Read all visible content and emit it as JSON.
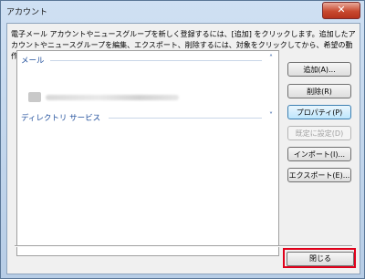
{
  "window": {
    "title": "アカウント",
    "close_glyph": "✕"
  },
  "description": "電子メール アカウントやニュースグループを新しく登録するには、[追加] をクリックします。追加したアカウントやニュースグループを編集、エクスポート、削除するには、対象をクリックしてから、希望の動作をクリックします。",
  "list": {
    "groups": [
      {
        "label": "メール",
        "expanded": true,
        "chevron": "˄"
      },
      {
        "label": "ディレクトリ サービス",
        "expanded": false,
        "chevron": "˅"
      }
    ]
  },
  "buttons": {
    "add": "追加(A)...",
    "remove": "削除(R)",
    "properties": "プロパティ(P)",
    "set_default": "既定に設定(D)",
    "import": "インポート(I)...",
    "export": "エクスポート(E)...",
    "close": "閉じる"
  },
  "colors": {
    "highlight": "#e0001a",
    "group_header": "#1f4e9b"
  }
}
